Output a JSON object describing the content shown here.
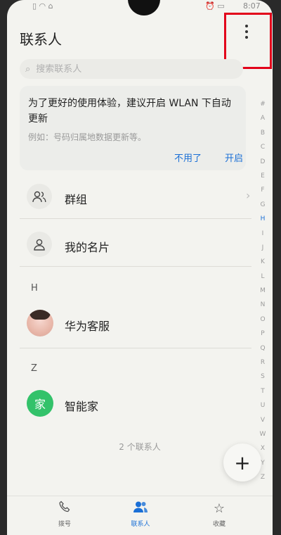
{
  "status_bar": {
    "left": "▯ ◠ ⌂",
    "right": "⏰ ▭",
    "time": "8:07"
  },
  "header": {
    "title": "联系人",
    "more_icon": "more-vertical-icon"
  },
  "search": {
    "placeholder": "搜索联系人"
  },
  "banner": {
    "message": "为了更好的使用体验，建议开启 WLAN 下自动更新",
    "subtext": "例如：号码归属地数据更新等。",
    "skip_label": "不用了",
    "enable_label": "开启"
  },
  "quick_items": [
    {
      "label": "群组",
      "icon": "group-icon"
    },
    {
      "label": "我的名片",
      "icon": "person-icon"
    }
  ],
  "sections": [
    {
      "header": "H",
      "contacts": [
        {
          "name": "华为客服",
          "avatar": "photo"
        }
      ]
    },
    {
      "header": "Z",
      "contacts": [
        {
          "name": "智能家",
          "avatar_text": "家",
          "avatar_color": "#33c26a"
        }
      ]
    }
  ],
  "contact_count": "2 个联系人",
  "alphabet": [
    "#",
    "A",
    "B",
    "C",
    "D",
    "E",
    "F",
    "G",
    "H",
    "I",
    "J",
    "K",
    "L",
    "M",
    "N",
    "O",
    "P",
    "Q",
    "R",
    "S",
    "T",
    "U",
    "V",
    "W",
    "X",
    "Y",
    "Z"
  ],
  "active_letter": "H",
  "bottom_nav": [
    {
      "label": "拨号",
      "icon": "phone-icon"
    },
    {
      "label": "联系人",
      "icon": "contacts-icon",
      "active": true
    },
    {
      "label": "收藏",
      "icon": "star-icon"
    }
  ],
  "accent_color": "#1a6fd6",
  "highlight_color": "#e2001a"
}
